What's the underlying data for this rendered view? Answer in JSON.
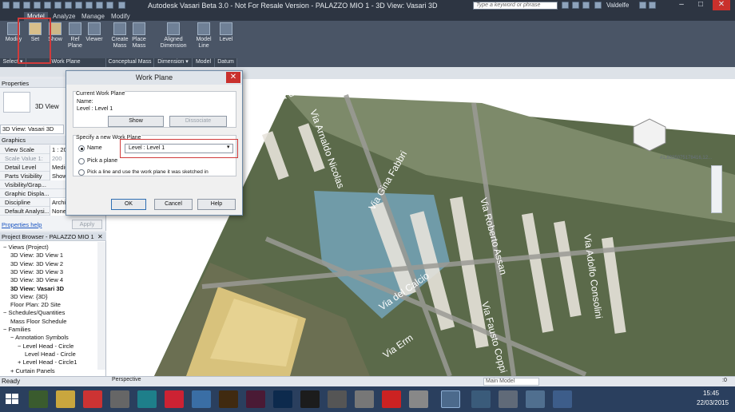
{
  "titlebar": {
    "title": "Autodesk Vasari Beta 3.0 - Not For Resale Version -    PALAZZO MIO 1 - 3D View: Vasari 3D",
    "search_placeholder": "Type a keyword or phrase",
    "user": "Valdelfe"
  },
  "ribbon": {
    "tabs": [
      "Model",
      "Analyze",
      "Manage",
      "Modify"
    ],
    "buttons": [
      {
        "label": "Modify"
      },
      {
        "label": "Set"
      },
      {
        "label": "Show"
      },
      {
        "label": "Ref\nPlane"
      },
      {
        "label": "Viewer"
      },
      {
        "label": "Create\nMass"
      },
      {
        "label": "Place\nMass"
      },
      {
        "label": "Aligned\nDimension"
      },
      {
        "label": "Model\nLine"
      },
      {
        "label": "Level"
      }
    ],
    "panels": [
      "Select ▾",
      "Work Plane",
      "Conceptual Mass",
      "Dimension ▾",
      "Model",
      "Datum"
    ]
  },
  "properties": {
    "header": "Properties",
    "type_label": "3D View",
    "view_selector": "3D View: Vasari 3D",
    "edit_type": "Edit Ty",
    "section": "Graphics",
    "rows": [
      {
        "k": "View Scale",
        "v": "1 : 200"
      },
      {
        "k": "Scale Value   1:",
        "v": "200"
      },
      {
        "k": "Detail Level",
        "v": "Medium"
      },
      {
        "k": "Parts Visibility",
        "v": "Show Orig"
      },
      {
        "k": "Visibility/Grap...",
        "v": ""
      },
      {
        "k": "Graphic Displa...",
        "v": ""
      },
      {
        "k": "Discipline",
        "v": "Architectu"
      },
      {
        "k": "Default Analysi...",
        "v": "None"
      }
    ],
    "help_link": "Properties help",
    "apply": "Apply"
  },
  "browser": {
    "header": "Project Browser - PALAZZO MIO 1",
    "items": [
      {
        "label": "Views (Project)",
        "indent": 0,
        "sign": "−",
        "bold": false
      },
      {
        "label": "3D View: 3D View 1",
        "indent": 1,
        "bold": false
      },
      {
        "label": "3D View: 3D View 2",
        "indent": 1,
        "bold": false
      },
      {
        "label": "3D View: 3D View 3",
        "indent": 1,
        "bold": false
      },
      {
        "label": "3D View: 3D View 4",
        "indent": 1,
        "bold": false
      },
      {
        "label": "3D View: Vasari 3D",
        "indent": 1,
        "bold": true
      },
      {
        "label": "3D View: {3D}",
        "indent": 1,
        "bold": false
      },
      {
        "label": "Floor Plan: 2D Site",
        "indent": 1,
        "bold": false
      },
      {
        "label": "Schedules/Quantities",
        "indent": 0,
        "sign": "−",
        "bold": false
      },
      {
        "label": "Mass Floor Schedule",
        "indent": 1,
        "bold": false
      },
      {
        "label": "Families",
        "indent": 0,
        "sign": "−",
        "bold": false
      },
      {
        "label": "Annotation Symbols",
        "indent": 1,
        "sign": "−",
        "bold": false
      },
      {
        "label": "Level Head - Circle",
        "indent": 2,
        "sign": "−",
        "bold": false
      },
      {
        "label": "Level Head - Circle",
        "indent": 3,
        "bold": false
      },
      {
        "label": "Level Head - Circle1",
        "indent": 2,
        "sign": "+",
        "bold": false
      },
      {
        "label": "Curtain Panels",
        "indent": 1,
        "sign": "+",
        "bold": false
      },
      {
        "label": "Entourage",
        "indent": 1,
        "sign": "+",
        "bold": false
      }
    ]
  },
  "dialog": {
    "title": "Work Plane",
    "current_group": "Current Work Plane",
    "name_label": "Name:",
    "name_value": "Level : Level 1",
    "show": "Show",
    "dissociate": "Dissociate",
    "specify_group": "Specify a new Work Plane",
    "opt_name": "Name",
    "select_value": "Level : Level 1",
    "opt_pick_plane": "Pick a plane",
    "opt_pick_line": "Pick a line and use the work plane it was sketched in",
    "ok": "OK",
    "cancel": "Cancel",
    "help": "Help"
  },
  "viewport": {
    "street_labels": [
      "Via Roberto Assan",
      "Via Arnaldo Nicolas",
      "Via Adolfo Consolini",
      "Via Fausto Coppi",
      "Via del Calcio",
      "Via del Calcio",
      "Via Erm",
      "Via Gina Fabbri"
    ],
    "coord": "#1,8335075178416,12...",
    "view_bar_label": "Perspective"
  },
  "status": {
    "text": "Ready",
    "model": "Main Model",
    "filter": ":0"
  },
  "taskbar": {
    "time": "15:45",
    "date": "22/03/2015"
  },
  "colors": {
    "dark": "#2d3542",
    "ribbon": "#4a5566",
    "accent_red": "#d13b3b",
    "taskbar": "#2a3f5e"
  }
}
